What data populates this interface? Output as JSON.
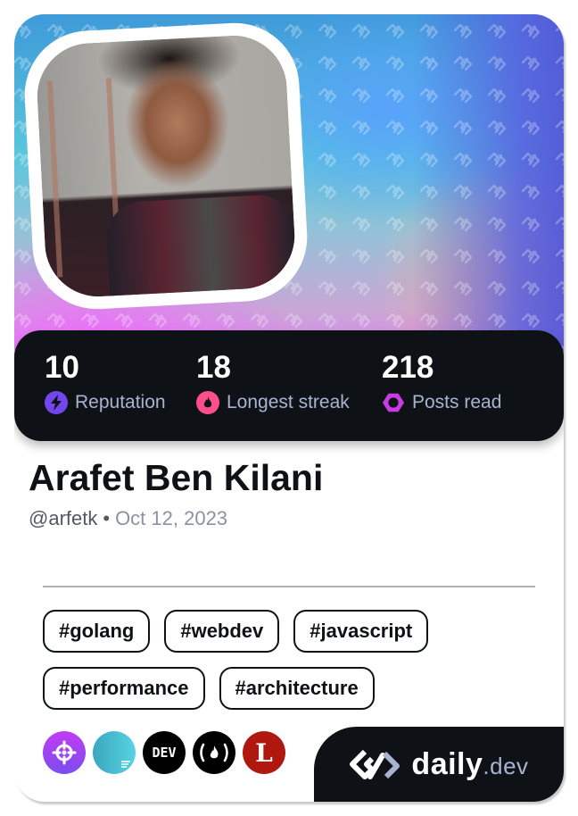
{
  "stats": [
    {
      "value": "10",
      "label": "Reputation",
      "icon": "lightning-icon",
      "color": "#7147ed"
    },
    {
      "value": "18",
      "label": "Longest streak",
      "icon": "flame-icon",
      "color": "#ff4f8a"
    },
    {
      "value": "218",
      "label": "Posts read",
      "icon": "hexagon-ring-icon",
      "color": "#c73ce5"
    }
  ],
  "profile": {
    "name": "Arafet Ben Kilani",
    "handle": "@arfetk",
    "separator": "•",
    "joined": "Oct 12, 2023"
  },
  "tags": [
    "#golang",
    "#webdev",
    "#javascript",
    "#performance",
    "#architecture"
  ],
  "sources": [
    {
      "name": "crosshair-source",
      "icon": "crosshair-icon",
      "color": "#a53ff2"
    },
    {
      "name": "hashnode-like-source",
      "icon": "gradient-disc-icon",
      "color": "#45b8cf"
    },
    {
      "name": "dev-to-source",
      "icon": "dev-icon",
      "label": "DEV",
      "color": "#000000"
    },
    {
      "name": "freecodecamp-source",
      "icon": "campfire-icon",
      "label": "(🔥)",
      "color": "#000000"
    },
    {
      "name": "l-source",
      "icon": "letter-l-icon",
      "label": "L",
      "color": "#b0170f"
    }
  ],
  "brand": {
    "name": "daily",
    "tld": ".dev"
  }
}
